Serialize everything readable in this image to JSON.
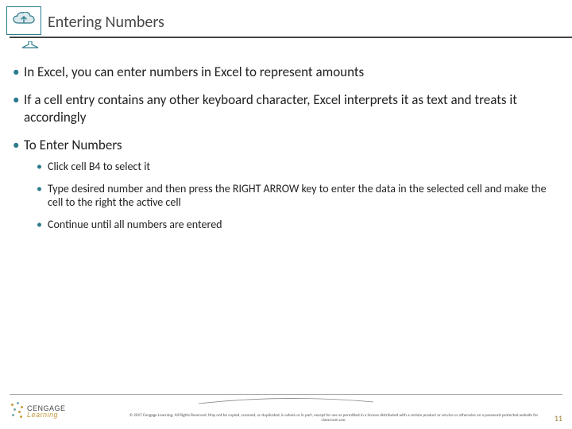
{
  "header": {
    "title": "Entering Numbers",
    "icon": "cloud-upload-icon"
  },
  "bullets": [
    {
      "text": "In Excel, you can enter numbers in Excel to represent amounts"
    },
    {
      "text": "If a cell entry contains any other keyboard character, Excel interprets it as text and treats it accordingly"
    },
    {
      "text": "To Enter Numbers",
      "children": [
        {
          "text": "Click cell B4 to select it"
        },
        {
          "text": "Type desired number and then press the RIGHT ARROW key to enter the data in the selected cell and make the cell to the right the active cell"
        },
        {
          "text": "Continue until all numbers are entered"
        }
      ]
    }
  ],
  "footer": {
    "logo_line1": "CENGAGE",
    "logo_line2": "Learning",
    "copyright": "© 2017 Cengage Learning. All Rights Reserved. May not be copied, scanned, or duplicated, in whole or in part, except for use as permitted in a license distributed with a certain product or service or otherwise on a password-protected website for classroom use.",
    "page_number": "11"
  },
  "colors": {
    "accent": "#2a7a8c",
    "gold": "#c49b3f"
  }
}
